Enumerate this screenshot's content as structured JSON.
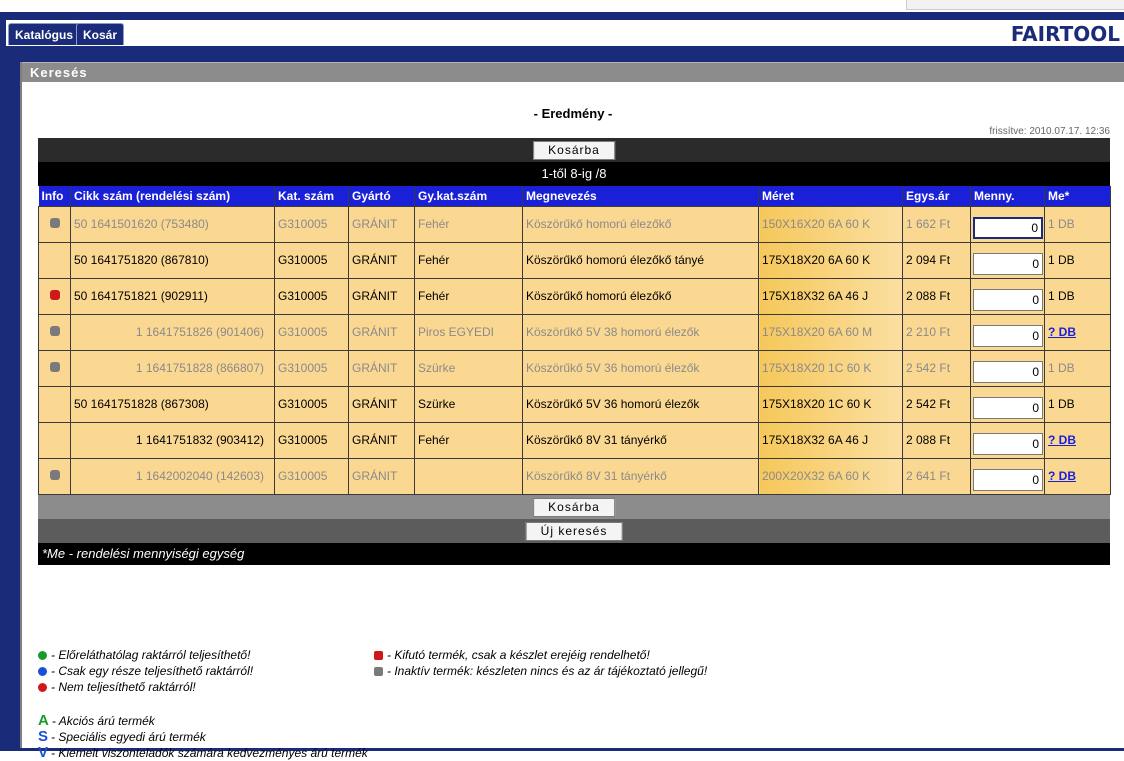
{
  "tabs": [
    "Katalógus",
    "Kosár"
  ],
  "logo": "FAIRTOOL",
  "panel_title": "Keresés",
  "result_title": "- Eredmény -",
  "updated": "frissítve: 2010.07.17. 12:36",
  "buttons": {
    "cart": "Kosárba",
    "new_search": "Új keresés"
  },
  "pager": "1-től 8-ig /8",
  "columns": [
    "Info",
    "Cikk szám (rendelési szám)",
    "Kat. szám",
    "Gyártó",
    "Gy.kat.szám",
    "Megnevezés",
    "Méret",
    "Egys.ár",
    "Menny.",
    "Me*"
  ],
  "rows": [
    {
      "status": "inactive",
      "info": "gray",
      "cikk": "50 1641501620  (753480)",
      "kat": "G310005",
      "gyarto": "GRÁNIT",
      "gykat": "Fehér",
      "megnevezes": "Köszörűkő homorú élezőkő",
      "meret": "150X16X20 6A 60 K",
      "ar": "1 662 Ft",
      "menny": "0",
      "me": "1 DB",
      "me_link": false
    },
    {
      "status": "active",
      "info": "",
      "cikk": "50 1641751820  (867810)",
      "kat": "G310005",
      "gyarto": "GRÁNIT",
      "gykat": "Fehér",
      "megnevezes": "Köszörűkő homorú élezőkő tányé",
      "meret": "175X18X20 6A 60 K",
      "ar": "2 094 Ft",
      "menny": "0",
      "me": "1 DB",
      "me_link": false
    },
    {
      "status": "active",
      "info": "red",
      "cikk": "50 1641751821  (902911)",
      "kat": "G310005",
      "gyarto": "GRÁNIT",
      "gykat": "Fehér",
      "megnevezes": "Köszörűkő homorú élezőkő",
      "meret": "175X18X32 6A 46 J",
      "ar": "2 088 Ft",
      "menny": "0",
      "me": "1 DB",
      "me_link": false
    },
    {
      "status": "inactive",
      "info": "gray",
      "cikk": "1 1641751826  (901406)",
      "kat": "G310005",
      "gyarto": "GRÁNIT",
      "gykat": "Piros EGYEDI",
      "megnevezes": "Köszörűkő 5V 38 homorú élezők",
      "meret": "175X18X20 6A 60 M",
      "ar": "2 210 Ft",
      "menny": "0",
      "me": "? DB",
      "me_link": true
    },
    {
      "status": "inactive",
      "info": "gray",
      "cikk": "1 1641751828  (866807)",
      "kat": "G310005",
      "gyarto": "GRÁNIT",
      "gykat": "Szürke",
      "megnevezes": "Köszörűkő 5V 36 homorú élezők",
      "meret": "175X18X20 1C 60 K",
      "ar": "2 542 Ft",
      "menny": "0",
      "me": "1 DB",
      "me_link": false
    },
    {
      "status": "active",
      "info": "",
      "cikk": "50 1641751828  (867308)",
      "kat": "G310005",
      "gyarto": "GRÁNIT",
      "gykat": "Szürke",
      "megnevezes": "Köszörűkő 5V 36 homorú élezők",
      "meret": "175X18X20 1C 60 K",
      "ar": "2 542 Ft",
      "menny": "0",
      "me": "1 DB",
      "me_link": false
    },
    {
      "status": "active",
      "info": "",
      "cikk": "1 1641751832  (903412)",
      "kat": "G310005",
      "gyarto": "GRÁNIT",
      "gykat": "Fehér",
      "megnevezes": "Köszörűkő 8V 31 tányérkő",
      "meret": "175X18X32 6A 46 J",
      "ar": "2 088 Ft",
      "menny": "0",
      "me": "? DB",
      "me_link": true
    },
    {
      "status": "inactive",
      "info": "gray",
      "cikk": "1 1642002040  (142603)",
      "kat": "G310005",
      "gyarto": "GRÁNIT",
      "gykat": "",
      "megnevezes": "Köszörűkő 8V 31 tányérkő",
      "meret": "200X20X32 6A 60 K",
      "ar": "2 641 Ft",
      "menny": "0",
      "me": "? DB",
      "me_link": true
    }
  ],
  "footnote": "*Me - rendelési mennyiségi egység",
  "legend": {
    "green": "- Előreláthatólag raktárról teljesíthető!",
    "blue": "- Csak egy része teljesíthető raktárról!",
    "red": "- Nem teljesíthető raktárról!",
    "kifuto": "- Kifutó termék, csak a készlet erejéig rendelhető!",
    "inaktiv": "- Inaktív termék: készleten nincs és az ár tájékoztató jellegű!",
    "a_letter": "A",
    "a_text": "- Akciós árú termék",
    "s_letter": "S",
    "s_text": "- Speciális egyedi árú termék",
    "v_letter": "V",
    "v_text": "- Kiemelt viszonteladók számára kedvezményes árú termék"
  }
}
